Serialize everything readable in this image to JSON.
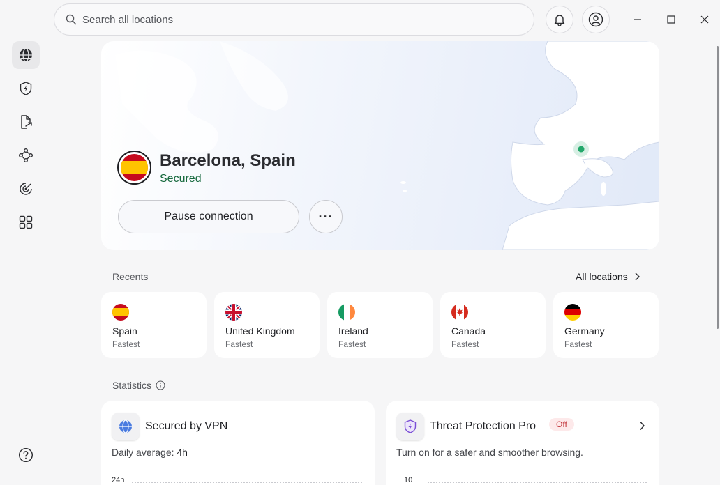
{
  "search": {
    "placeholder": "Search all locations"
  },
  "connection": {
    "location": "Barcelona, Spain",
    "status": "Secured",
    "pause_label": "Pause connection",
    "more_label": "···"
  },
  "recents": {
    "heading": "Recents",
    "all_locations": "All locations",
    "items": [
      {
        "country": "Spain",
        "sub": "Fastest"
      },
      {
        "country": "United Kingdom",
        "sub": "Fastest"
      },
      {
        "country": "Ireland",
        "sub": "Fastest"
      },
      {
        "country": "Canada",
        "sub": "Fastest"
      },
      {
        "country": "Germany",
        "sub": "Fastest"
      }
    ]
  },
  "statistics": {
    "heading": "Statistics",
    "vpn": {
      "title": "Secured by VPN",
      "daily_label": "Daily average:",
      "daily_value": "4h",
      "axis_top": "24h"
    },
    "threat": {
      "title": "Threat Protection Pro",
      "badge": "Off",
      "description": "Turn on for a safer and smoother browsing.",
      "axis_top": "10"
    }
  },
  "colors": {
    "secured": "#17693e",
    "off_badge": "#c2353b",
    "accent_dot": "#23a86b"
  }
}
